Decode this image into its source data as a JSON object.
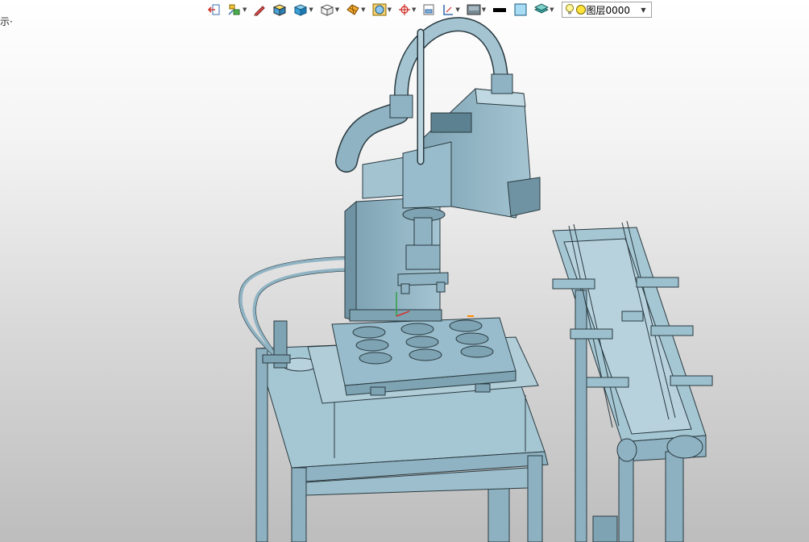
{
  "status": {
    "text": "示·"
  },
  "toolbar": {
    "tools": [
      {
        "name": "exit-icon",
        "has_menu": false
      },
      {
        "name": "reference-icon",
        "has_menu": true
      },
      {
        "name": "sketch-pen-icon",
        "has_menu": false
      },
      {
        "name": "solid-box-icon",
        "has_menu": false
      },
      {
        "name": "cube-color-icon",
        "has_menu": true
      },
      {
        "name": "wireframe-cube-icon",
        "has_menu": true
      },
      {
        "name": "surface-icon",
        "has_menu": true
      },
      {
        "name": "render-sphere-icon",
        "has_menu": true
      },
      {
        "name": "coordinate-system-icon",
        "has_menu": true
      },
      {
        "name": "section-view-icon",
        "has_menu": false
      },
      {
        "name": "dimension-icon",
        "has_menu": true
      },
      {
        "name": "display-style-icon",
        "has_menu": true
      },
      {
        "name": "line-color-icon",
        "has_menu": false
      },
      {
        "name": "fill-color-icon",
        "has_menu": false
      },
      {
        "name": "layer-stack-icon",
        "has_menu": true
      }
    ],
    "layer_select": {
      "value": "图层0000"
    }
  },
  "colors": {
    "model": "#8fb3c3",
    "model_dark": "#6b909f",
    "edge": "#2a3a40",
    "accent": "#ff8a00"
  }
}
